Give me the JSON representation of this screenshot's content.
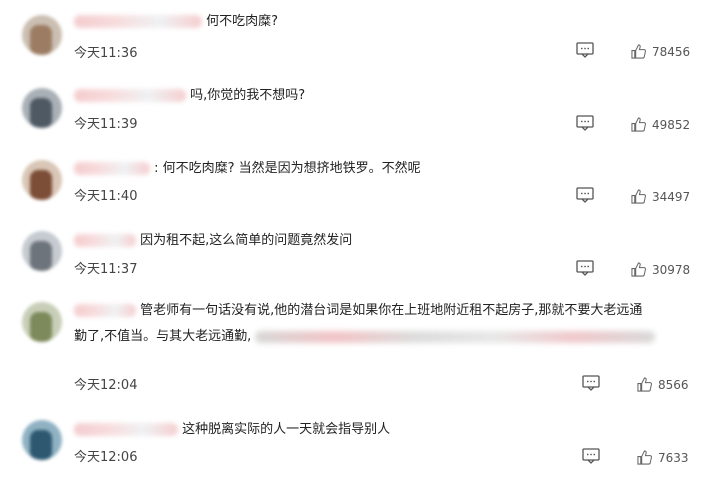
{
  "comments": [
    {
      "text": "何不吃肉糜?",
      "time": "今天11:36",
      "likes": "78456"
    },
    {
      "text": "吗,你觉的我不想吗?",
      "time": "今天11:39",
      "likes": "49852"
    },
    {
      "text": ": 何不吃肉糜? 当然是因为想挤地铁罗。不然呢",
      "time": "今天11:40",
      "likes": "34497"
    },
    {
      "text": "因为租不起,这么简单的问题竟然发问",
      "time": "今天11:37",
      "likes": "30978"
    },
    {
      "text": "管老师有一句话没有说,他的潜台词是如果你在上班地附近租不起房子,那就不要大老远通",
      "text2": "勤了,不值当。与其大老远通勤,",
      "time": "今天12:04",
      "likes": "8566"
    },
    {
      "text": "这种脱离实际的人一天就会指导别人",
      "time": "今天12:06",
      "likes": "7633"
    }
  ],
  "colors": {
    "avatar1": "#bfae9c",
    "avatar2": "#5d6b78",
    "avatar3": "#8a5e48",
    "avatar4": "#7e8a97",
    "avatar5": "#8c9a6e",
    "avatar6": "#2f5e77"
  },
  "icons": {
    "reply": "comment-icon",
    "like": "thumbs-up-icon"
  }
}
